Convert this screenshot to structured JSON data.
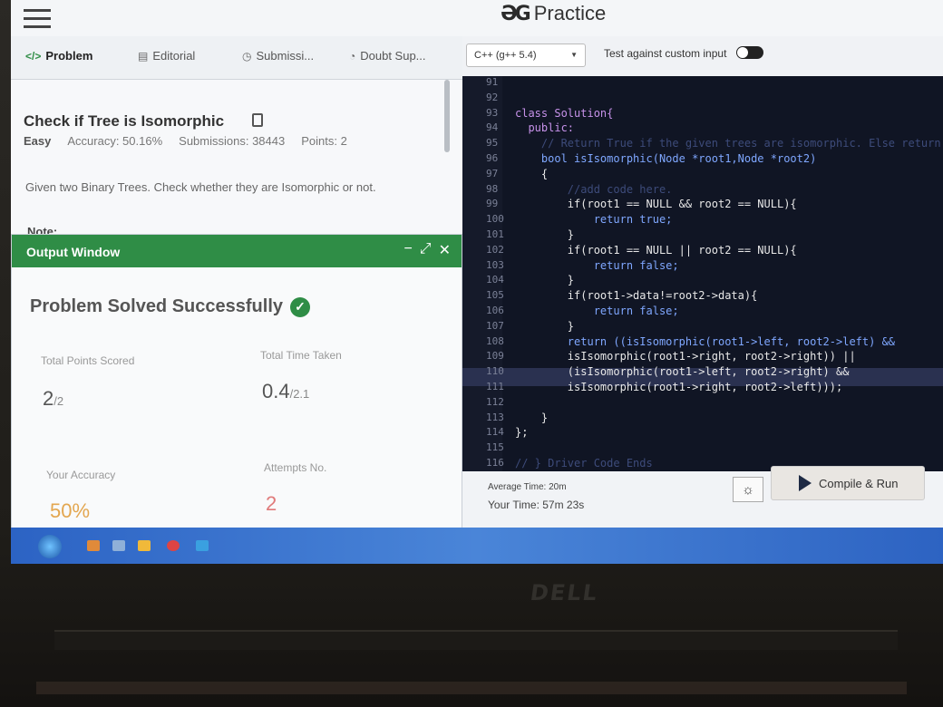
{
  "header": {
    "brand": "Practice",
    "brand_mark": "ƏG"
  },
  "tabs": [
    {
      "label": "Problem",
      "icon": "code-icon"
    },
    {
      "label": "Editorial",
      "icon": "editorial-icon"
    },
    {
      "label": "Submissi...",
      "icon": "clock-icon"
    },
    {
      "label": "Doubt Sup...",
      "icon": "doubt-icon"
    }
  ],
  "problem": {
    "title": "Check if Tree is Isomorphic",
    "difficulty": "Easy",
    "accuracy": "Accuracy: 50.16%",
    "submissions": "Submissions: 38443",
    "points": "Points: 2",
    "description": "Given two Binary Trees. Check whether they are Isomorphic or not.",
    "note": "Note:"
  },
  "output": {
    "title": "Output Window",
    "controls": "- ⤢ ✕",
    "message": "Problem Solved Successfully",
    "points_label": "Total Points Scored",
    "points_value": "2",
    "points_total": "/2",
    "time_label": "Total Time Taken",
    "time_value": "0.4",
    "time_total": "/2.1",
    "accuracy_label": "Your Accuracy",
    "accuracy_value": "50%",
    "attempts_label": "Attempts No.",
    "attempts_value": "2"
  },
  "editor": {
    "language": "C++ (g++ 5.4)",
    "custom_input_label": "Test against custom input",
    "line_numbers": [
      "91",
      "92",
      "93",
      "94",
      "95",
      "96",
      "97",
      "98",
      "99",
      "100",
      "101",
      "102",
      "103",
      "104",
      "105",
      "106",
      "107",
      "108",
      "109",
      "110",
      "111",
      "112",
      "113",
      "114",
      "115",
      "116"
    ],
    "code_lines": [
      "class Solution{",
      "  public:",
      "    // Return True if the given trees are isomorphic. Else return False.",
      "    bool isIsomorphic(Node *root1,Node *root2)",
      "    {",
      "        //add code here.",
      "        if(root1 == NULL && root2 == NULL){",
      "            return true;",
      "        }",
      "        if(root1 == NULL || root2 == NULL){",
      "            return false;",
      "        }",
      "        if(root1->data!=root2->data){",
      "            return false;",
      "        }",
      "        return ((isIsomorphic(root1->left, root2->left) &&",
      "        isIsomorphic(root1->right, root2->right)) ||",
      "        (isIsomorphic(root1->left, root2->right) &&",
      "        isIsomorphic(root1->right, root2->left)));",
      "    }",
      "};",
      "// } Driver Code Ends"
    ],
    "average_time": "Average Time: 20m",
    "your_time": "Your Time: 57m 23s",
    "run_label": "Compile & Run"
  },
  "colors": {
    "accent": "#2f8d46",
    "editor_bg": "#101524",
    "taskbar": "#3b74cf"
  }
}
